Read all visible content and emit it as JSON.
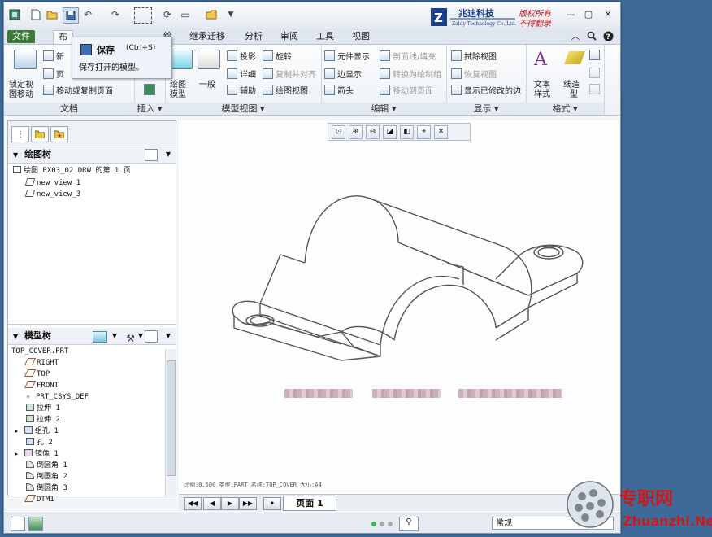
{
  "qat": {
    "save_tooltip_title": "保存",
    "save_shortcut": "(Ctrl+S)",
    "save_tooltip_desc": "保存打开的模型。"
  },
  "logo": {
    "company_cn": "兆迪科技",
    "company_en": "Zaldy Technology Co.,Ltd.",
    "slogan1": "版权所有",
    "slogan2": "不得翻录",
    "mark": "Z"
  },
  "tabs": [
    "文件",
    "布",
    "绘",
    "继承迁移",
    "分析",
    "审阅",
    "工具",
    "视图"
  ],
  "ribbon": {
    "doc": {
      "lock": "锁定视",
      "lock2": "图移动",
      "new_sheet": "新",
      "page": "页",
      "move_copy": "移动或复制页面",
      "label": "文档"
    },
    "insert": {
      "label": "插入"
    },
    "model_views": {
      "drawing_model": "绘图",
      "drawing_model2": "模型",
      "general": "一般",
      "projection": "投影",
      "detailed": "详细",
      "auxiliary": "辅助",
      "revolve": "旋转",
      "copy_align": "复制并对齐",
      "drawing_view": "绘图视图",
      "label": "模型视图"
    },
    "edit": {
      "elem_display": "元件显示",
      "edge_display": "边显示",
      "arrow": "箭头",
      "section_line": "剖面线/填充",
      "convert_draw": "转换为绘制组",
      "move_page": "移动到页面",
      "label": "编辑"
    },
    "display": {
      "erase_view": "拭除视图",
      "restore_view": "恢复视图",
      "show_modified": "显示已修改的边",
      "label": "显示"
    },
    "format": {
      "text_style": "文本",
      "text_style2": "样式",
      "line_style": "线造",
      "line_style2": "型",
      "label": "格式"
    }
  },
  "drawing_tree": {
    "title": "绘图树",
    "root": "绘图 EX03_02 DRW 的第 1 页",
    "items": [
      "new_view_1",
      "new_view_3"
    ]
  },
  "model_tree": {
    "title": "模型树",
    "root": "TOP_COVER.PRT",
    "items": [
      "RIGHT",
      "TOP",
      "FRONT",
      "PRT_CSYS_DEF",
      "拉伸 1",
      "拉伸 2",
      "组孔_1",
      "孔 2",
      "镜像 1",
      "倒圆角 1",
      "倒圆角 2",
      "倒圆角 3",
      "DTM1"
    ]
  },
  "canvas": {
    "status_text": "比例:0.500   类型:PART   名称:TOP_COVER   大小:A4"
  },
  "pagebar": {
    "page_label": "页面 1"
  },
  "statusbar": {
    "filter": "常规"
  },
  "watermark": {
    "cn": "专职网",
    "en": "Zhuanzhi.Net"
  },
  "colors": {
    "accent": "#3e7a3a",
    "desktop": "#3d6a98",
    "watermark_red": "#d01818"
  }
}
